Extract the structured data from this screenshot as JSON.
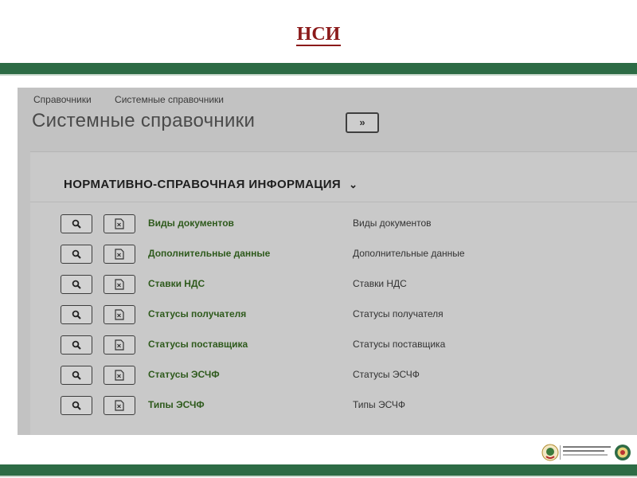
{
  "slide": {
    "title": "НСИ"
  },
  "app": {
    "breadcrumbs": [
      "Справочники",
      "Системные справочники"
    ],
    "page_title": "Системные справочники",
    "expand_button_label": "»",
    "section_title": "НОРМАТИВНО-СПРАВОЧНАЯ ИНФОРМАЦИЯ",
    "section_chevron": "⌄",
    "rows": [
      {
        "name": "Виды документов",
        "description": "Виды документов"
      },
      {
        "name": "Дополнительные данные",
        "description": "Дополнительные данные"
      },
      {
        "name": "Ставки НДС",
        "description": "Ставки НДС"
      },
      {
        "name": "Статусы получателя",
        "description": "Статусы получателя"
      },
      {
        "name": "Статусы поставщика",
        "description": "Статусы поставщика"
      },
      {
        "name": "Статусы ЭСЧФ",
        "description": "Статусы ЭСЧФ"
      },
      {
        "name": "Типы ЭСЧФ",
        "description": "Типы ЭСЧФ"
      }
    ],
    "row_icons": {
      "view": "search-icon",
      "export": "excel-file-icon"
    }
  },
  "colors": {
    "band_green": "#2d6b45",
    "title_red": "#8b1a1a",
    "link_green": "#2e5a1c"
  }
}
